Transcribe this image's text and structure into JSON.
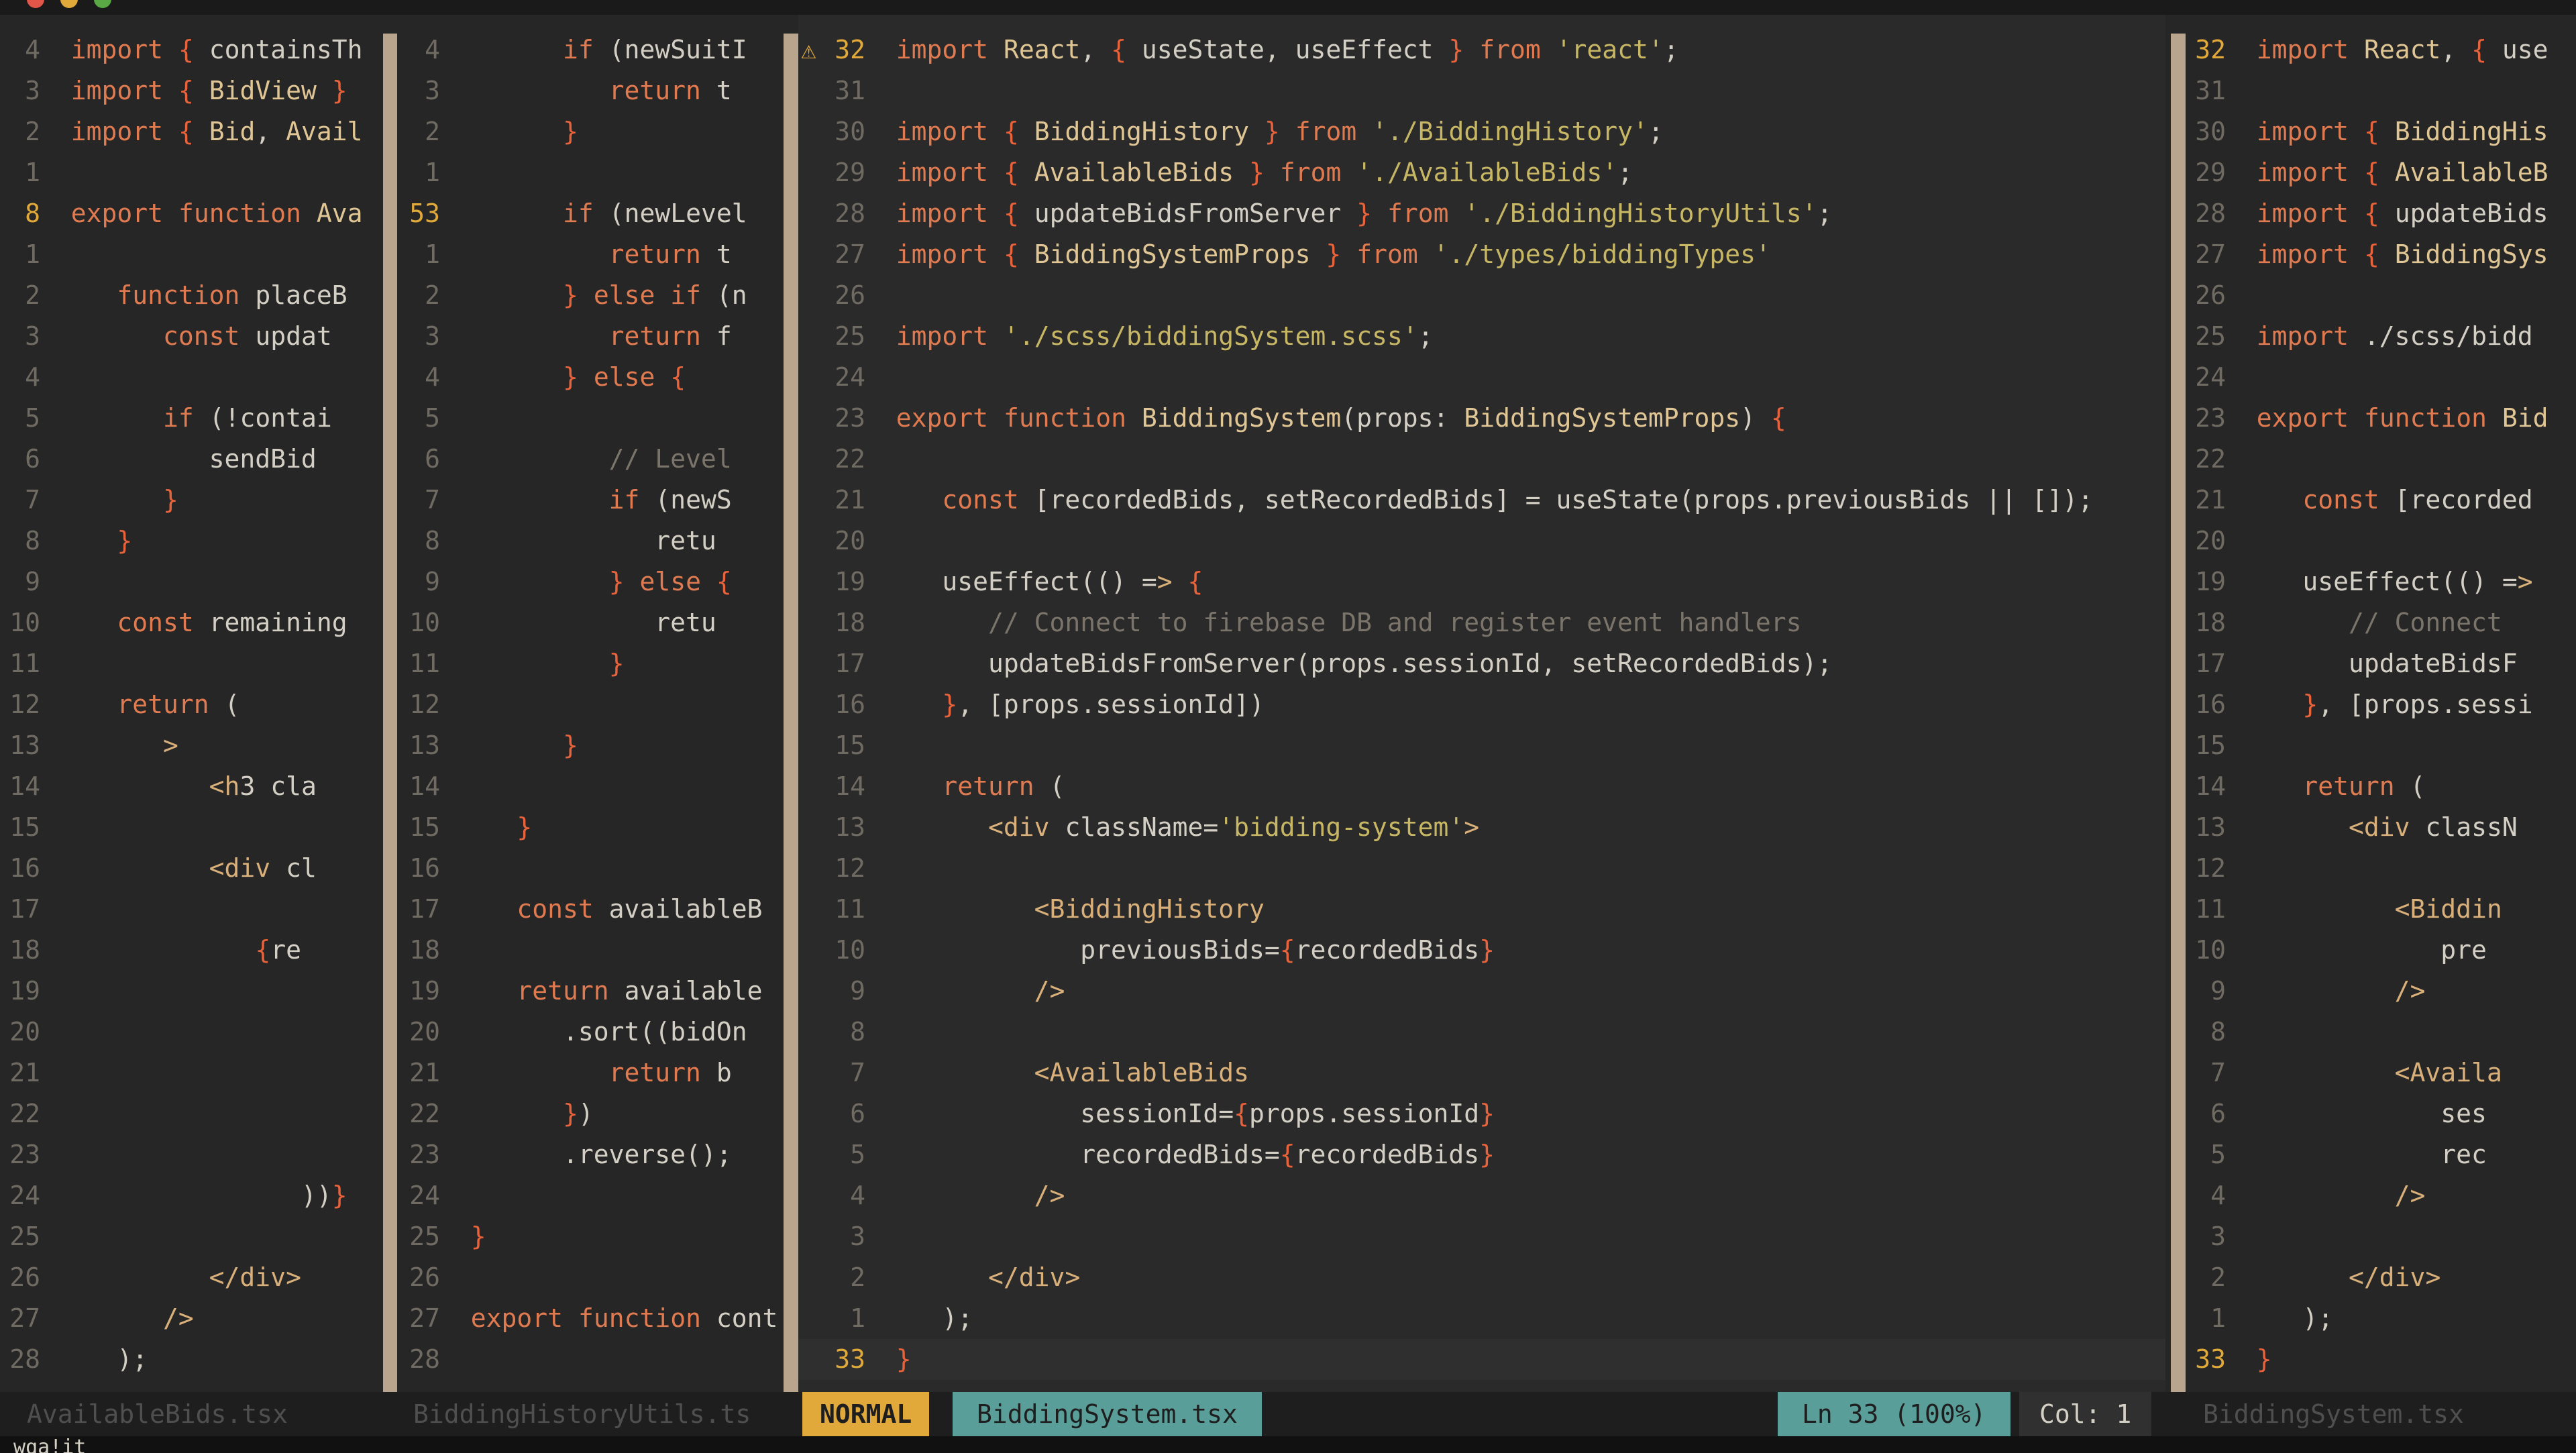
{
  "window": {
    "title": ""
  },
  "colors": {
    "keyword": "#e07a50",
    "string": "#c7b765",
    "type": "#e0c694",
    "comment": "#7a746a",
    "jsx": "#d9b07a",
    "brace": "#e8623b",
    "linenr": "#6f6a62",
    "cursorlinenr": "#e0a93a",
    "mode_bg": "#e0a93a",
    "file_bg": "#5a9e9a",
    "separator": "#b9a48d"
  },
  "panes": [
    {
      "file": "AvailableBids.tsx",
      "lines": [
        {
          "n": "4",
          "t": "import { containsTh"
        },
        {
          "n": "3",
          "t": "import { BidView }"
        },
        {
          "n": "2",
          "t": "import { Bid, Avail"
        },
        {
          "n": "1",
          "t": ""
        },
        {
          "n": "8",
          "t": "export function Ava",
          "cur": true
        },
        {
          "n": "1",
          "t": ""
        },
        {
          "n": "2",
          "t": "   function placeB"
        },
        {
          "n": "3",
          "t": "      const updat"
        },
        {
          "n": "4",
          "t": ""
        },
        {
          "n": "5",
          "t": "      if (!contai"
        },
        {
          "n": "6",
          "t": "         sendBid"
        },
        {
          "n": "7",
          "t": "      }"
        },
        {
          "n": "8",
          "t": "   }"
        },
        {
          "n": "9",
          "t": ""
        },
        {
          "n": "10",
          "t": "   const remaining"
        },
        {
          "n": "11",
          "t": ""
        },
        {
          "n": "12",
          "t": "   return ("
        },
        {
          "n": "13",
          "t": "      <>"
        },
        {
          "n": "14",
          "t": "         <h3 cla"
        },
        {
          "n": "15",
          "t": ""
        },
        {
          "n": "16",
          "t": "         <div cl"
        },
        {
          "n": "17",
          "t": ""
        },
        {
          "n": "18",
          "t": "            {re"
        },
        {
          "n": "19",
          "t": ""
        },
        {
          "n": "20",
          "t": ""
        },
        {
          "n": "21",
          "t": ""
        },
        {
          "n": "22",
          "t": ""
        },
        {
          "n": "23",
          "t": ""
        },
        {
          "n": "24",
          "t": "               ))}"
        },
        {
          "n": "25",
          "t": ""
        },
        {
          "n": "26",
          "t": "         </div>"
        },
        {
          "n": "27",
          "t": "      </>"
        },
        {
          "n": "28",
          "t": "   );"
        }
      ]
    },
    {
      "file": "BiddingHistoryUtils.ts",
      "lines": [
        {
          "n": "4",
          "t": "      if (newSuitI"
        },
        {
          "n": "3",
          "t": "         return t"
        },
        {
          "n": "2",
          "t": "      }"
        },
        {
          "n": "1",
          "t": ""
        },
        {
          "n": "53",
          "t": "      if (newLevel",
          "cur": true
        },
        {
          "n": "1",
          "t": "         return t"
        },
        {
          "n": "2",
          "t": "      } else if (n"
        },
        {
          "n": "3",
          "t": "         return f"
        },
        {
          "n": "4",
          "t": "      } else {"
        },
        {
          "n": "5",
          "t": ""
        },
        {
          "n": "6",
          "t": "         // Level"
        },
        {
          "n": "7",
          "t": "         if (newS"
        },
        {
          "n": "8",
          "t": "            retu"
        },
        {
          "n": "9",
          "t": "         } else {"
        },
        {
          "n": "10",
          "t": "            retu"
        },
        {
          "n": "11",
          "t": "         }"
        },
        {
          "n": "12",
          "t": ""
        },
        {
          "n": "13",
          "t": "      }"
        },
        {
          "n": "14",
          "t": ""
        },
        {
          "n": "15",
          "t": "   }"
        },
        {
          "n": "16",
          "t": ""
        },
        {
          "n": "17",
          "t": "   const availableB"
        },
        {
          "n": "18",
          "t": ""
        },
        {
          "n": "19",
          "t": "   return available"
        },
        {
          "n": "20",
          "t": "      .sort((bidOn"
        },
        {
          "n": "21",
          "t": "         return b"
        },
        {
          "n": "22",
          "t": "      })"
        },
        {
          "n": "23",
          "t": "      .reverse();"
        },
        {
          "n": "24",
          "t": ""
        },
        {
          "n": "25",
          "t": "}"
        },
        {
          "n": "26",
          "t": ""
        },
        {
          "n": "27",
          "t": "export function cont"
        },
        {
          "n": "28",
          "t": ""
        }
      ]
    },
    {
      "file": "BiddingSystem.tsx",
      "warning_icon": "⚠",
      "lines": [
        {
          "n": "32",
          "t": "import React, { useState, useEffect } from 'react';",
          "cur": true
        },
        {
          "n": "31",
          "t": ""
        },
        {
          "n": "30",
          "t": "import { BiddingHistory } from './BiddingHistory';"
        },
        {
          "n": "29",
          "t": "import { AvailableBids } from './AvailableBids';"
        },
        {
          "n": "28",
          "t": "import { updateBidsFromServer } from './BiddingHistoryUtils';"
        },
        {
          "n": "27",
          "t": "import { BiddingSystemProps } from './types/biddingTypes'"
        },
        {
          "n": "26",
          "t": ""
        },
        {
          "n": "25",
          "t": "import './scss/biddingSystem.scss';"
        },
        {
          "n": "24",
          "t": ""
        },
        {
          "n": "23",
          "t": "export function BiddingSystem(props: BiddingSystemProps) {"
        },
        {
          "n": "22",
          "t": ""
        },
        {
          "n": "21",
          "t": "   const [recordedBids, setRecordedBids] = useState(props.previousBids || []);"
        },
        {
          "n": "20",
          "t": ""
        },
        {
          "n": "19",
          "t": "   useEffect(() => {"
        },
        {
          "n": "18",
          "t": "      // Connect to firebase DB and register event handlers"
        },
        {
          "n": "17",
          "t": "      updateBidsFromServer(props.sessionId, setRecordedBids);"
        },
        {
          "n": "16",
          "t": "   }, [props.sessionId])"
        },
        {
          "n": "15",
          "t": ""
        },
        {
          "n": "14",
          "t": "   return ("
        },
        {
          "n": "13",
          "t": "      <div className='bidding-system'>"
        },
        {
          "n": "12",
          "t": ""
        },
        {
          "n": "11",
          "t": "         <BiddingHistory"
        },
        {
          "n": "10",
          "t": "            previousBids={recordedBids}"
        },
        {
          "n": "9",
          "t": "         />"
        },
        {
          "n": "8",
          "t": ""
        },
        {
          "n": "7",
          "t": "         <AvailableBids"
        },
        {
          "n": "6",
          "t": "            sessionId={props.sessionId}"
        },
        {
          "n": "5",
          "t": "            recordedBids={recordedBids}"
        },
        {
          "n": "4",
          "t": "         />"
        },
        {
          "n": "3",
          "t": ""
        },
        {
          "n": "2",
          "t": "      </div>"
        },
        {
          "n": "1",
          "t": "   );"
        },
        {
          "n": "33",
          "t": "}",
          "cur": true,
          "cursorline": true
        }
      ]
    },
    {
      "file": "BiddingSystem.tsx",
      "lines": [
        {
          "n": "32",
          "t": "import React, { use",
          "cur": true
        },
        {
          "n": "31",
          "t": ""
        },
        {
          "n": "30",
          "t": "import { BiddingHis"
        },
        {
          "n": "29",
          "t": "import { AvailableB"
        },
        {
          "n": "28",
          "t": "import { updateBids"
        },
        {
          "n": "27",
          "t": "import { BiddingSys"
        },
        {
          "n": "26",
          "t": ""
        },
        {
          "n": "25",
          "t": "import './scss/bidd"
        },
        {
          "n": "24",
          "t": ""
        },
        {
          "n": "23",
          "t": "export function Bid"
        },
        {
          "n": "22",
          "t": ""
        },
        {
          "n": "21",
          "t": "   const [recorded"
        },
        {
          "n": "20",
          "t": ""
        },
        {
          "n": "19",
          "t": "   useEffect(() =>"
        },
        {
          "n": "18",
          "t": "      // Connect"
        },
        {
          "n": "17",
          "t": "      updateBidsF"
        },
        {
          "n": "16",
          "t": "   }, [props.sessi"
        },
        {
          "n": "15",
          "t": ""
        },
        {
          "n": "14",
          "t": "   return ("
        },
        {
          "n": "13",
          "t": "      <div classN"
        },
        {
          "n": "12",
          "t": ""
        },
        {
          "n": "11",
          "t": "         <Biddin"
        },
        {
          "n": "10",
          "t": "            pre"
        },
        {
          "n": "9",
          "t": "         />"
        },
        {
          "n": "8",
          "t": ""
        },
        {
          "n": "7",
          "t": "         <Availa"
        },
        {
          "n": "6",
          "t": "            ses"
        },
        {
          "n": "5",
          "t": "            rec"
        },
        {
          "n": "4",
          "t": "         />"
        },
        {
          "n": "3",
          "t": ""
        },
        {
          "n": "2",
          "t": "      </div>"
        },
        {
          "n": "1",
          "t": "   );"
        },
        {
          "n": "33",
          "t": "}",
          "cur": true
        }
      ]
    }
  ],
  "status": {
    "mode": "NORMAL",
    "position": "Ln 33 (100%)",
    "column": "Col: 1"
  },
  "cmdline": "wqa!it"
}
